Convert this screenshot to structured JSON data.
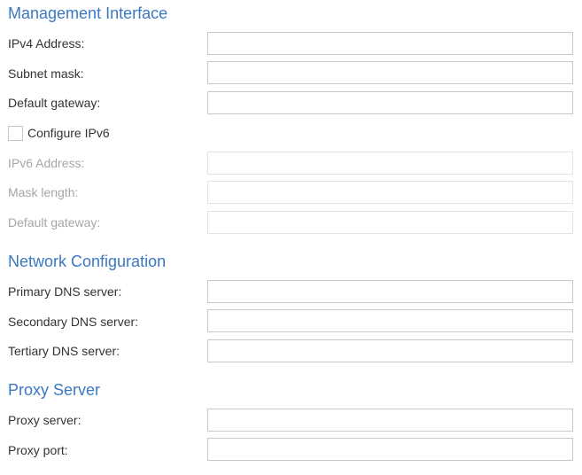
{
  "management": {
    "title": "Management Interface",
    "ipv4_address": {
      "label": "IPv4 Address:",
      "value": ""
    },
    "subnet_mask": {
      "label": "Subnet mask:",
      "value": ""
    },
    "default_gateway": {
      "label": "Default gateway:",
      "value": ""
    },
    "configure_ipv6": {
      "label": "Configure IPv6",
      "checked": false
    },
    "ipv6_address": {
      "label": "IPv6 Address:",
      "value": "",
      "disabled": true
    },
    "mask_length": {
      "label": "Mask length:",
      "value": "",
      "disabled": true
    },
    "ipv6_default_gateway": {
      "label": "Default gateway:",
      "value": "",
      "disabled": true
    }
  },
  "network": {
    "title": "Network Configuration",
    "primary_dns": {
      "label": "Primary DNS server:",
      "value": ""
    },
    "secondary_dns": {
      "label": "Secondary DNS server:",
      "value": ""
    },
    "tertiary_dns": {
      "label": "Tertiary DNS server:",
      "value": ""
    }
  },
  "proxy": {
    "title": "Proxy Server",
    "server": {
      "label": "Proxy server:",
      "value": ""
    },
    "port": {
      "label": "Proxy port:",
      "value": ""
    }
  },
  "colors": {
    "section_title": "#3b78c3",
    "label_text": "#333333",
    "disabled_text": "#a6a6a6",
    "input_border": "#c8c8c8",
    "disabled_border": "#e3e3e3"
  }
}
